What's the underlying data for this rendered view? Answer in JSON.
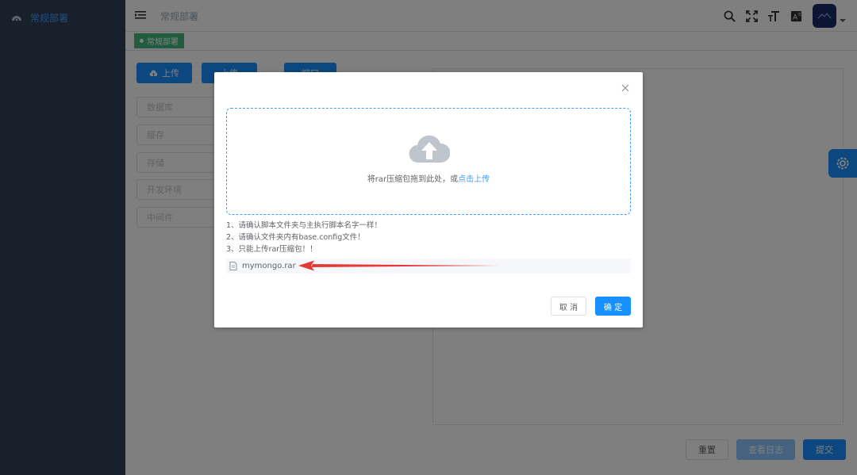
{
  "sidebar": {
    "items": [
      {
        "label": "常规部署",
        "icon": "dashboard-icon"
      }
    ]
  },
  "header": {
    "breadcrumb": "常规部署",
    "icons": [
      "search-icon",
      "fullscreen-icon",
      "font-size-icon",
      "translate-icon"
    ]
  },
  "tags": [
    {
      "label": "常规部署",
      "active": true
    }
  ],
  "main": {
    "upload_label": "上传",
    "button2_label": "上传",
    "button3_label": "端口",
    "fields": [
      {
        "placeholder": "数据库"
      },
      {
        "placeholder": "缓存"
      },
      {
        "placeholder": "存储"
      },
      {
        "placeholder": "开发环境"
      },
      {
        "placeholder": "中间件"
      }
    ],
    "reset_label": "重置",
    "log_label": "查看日志",
    "submit_label": "提交"
  },
  "dialog": {
    "close_icon": "close-icon",
    "drag_text": "将rar压缩包拖到此处，或",
    "drag_link": "点击上传",
    "tips": [
      "1、请确认脚本文件夹与主执行脚本名字一样！",
      "2、请确认文件夹内有base.config文件！",
      "3、只能上传rar压缩包！！"
    ],
    "file_name": "mymongo.rar",
    "cancel_label": "取 消",
    "ok_label": "确 定"
  },
  "colors": {
    "primary": "#1890ff",
    "sidebar_bg": "#304156",
    "tag_active": "#42b983",
    "annotation_arrow": "#e53935"
  }
}
